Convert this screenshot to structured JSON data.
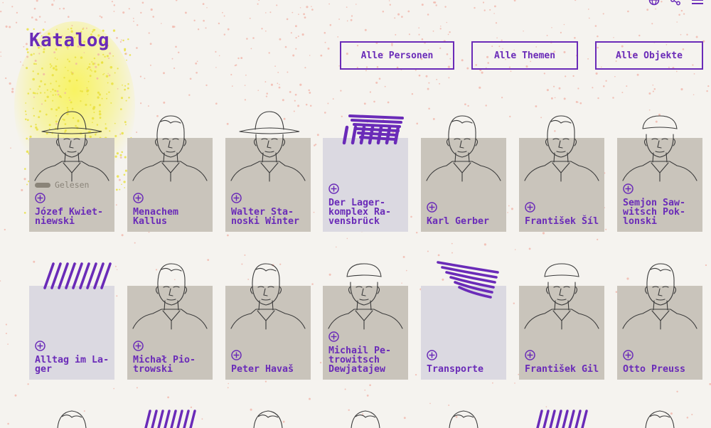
{
  "header": {
    "title": "Katalog",
    "icons": [
      "globe-icon",
      "share-icon",
      "menu-icon"
    ]
  },
  "filters": [
    {
      "label": "Alle Personen"
    },
    {
      "label": "Alle Themen"
    },
    {
      "label": "Alle Objekte"
    }
  ],
  "colors": {
    "accent": "#6a2bb8",
    "background": "#f5f3ef",
    "person_card": "#c9c4bb",
    "theme_card": "#dbd9e1",
    "dots": "#f0b2a6",
    "highlight": "#f8f35a"
  },
  "catalog": {
    "read_label": "Gelesen",
    "row1": [
      {
        "label": "Józef Kwiet-\nniewski",
        "kind": "person",
        "read": true
      },
      {
        "label": "Menachem\nKallus",
        "kind": "person"
      },
      {
        "label": "Walter Sta-\nnoski Winter",
        "kind": "person"
      },
      {
        "label": "Der Lager-\nkomplex Ra-\nvensbrück",
        "kind": "theme"
      },
      {
        "label": "Karl Gerber",
        "kind": "person"
      },
      {
        "label": "František Šíl",
        "kind": "person"
      },
      {
        "label": "Semjon Saw-\nwitsch Pok-\nlonski",
        "kind": "person"
      }
    ],
    "row2": [
      {
        "label": "Alltag im La-\nger",
        "kind": "theme"
      },
      {
        "label": "Michał Pio-\ntrowski",
        "kind": "person"
      },
      {
        "label": "Peter Havaš",
        "kind": "person"
      },
      {
        "label": "Michail Pe-\ntrowitsch\nDewjatajew",
        "kind": "person"
      },
      {
        "label": "Transporte",
        "kind": "theme"
      },
      {
        "label": "František Gil",
        "kind": "person"
      },
      {
        "label": "Otto Preuss",
        "kind": "person"
      }
    ]
  }
}
